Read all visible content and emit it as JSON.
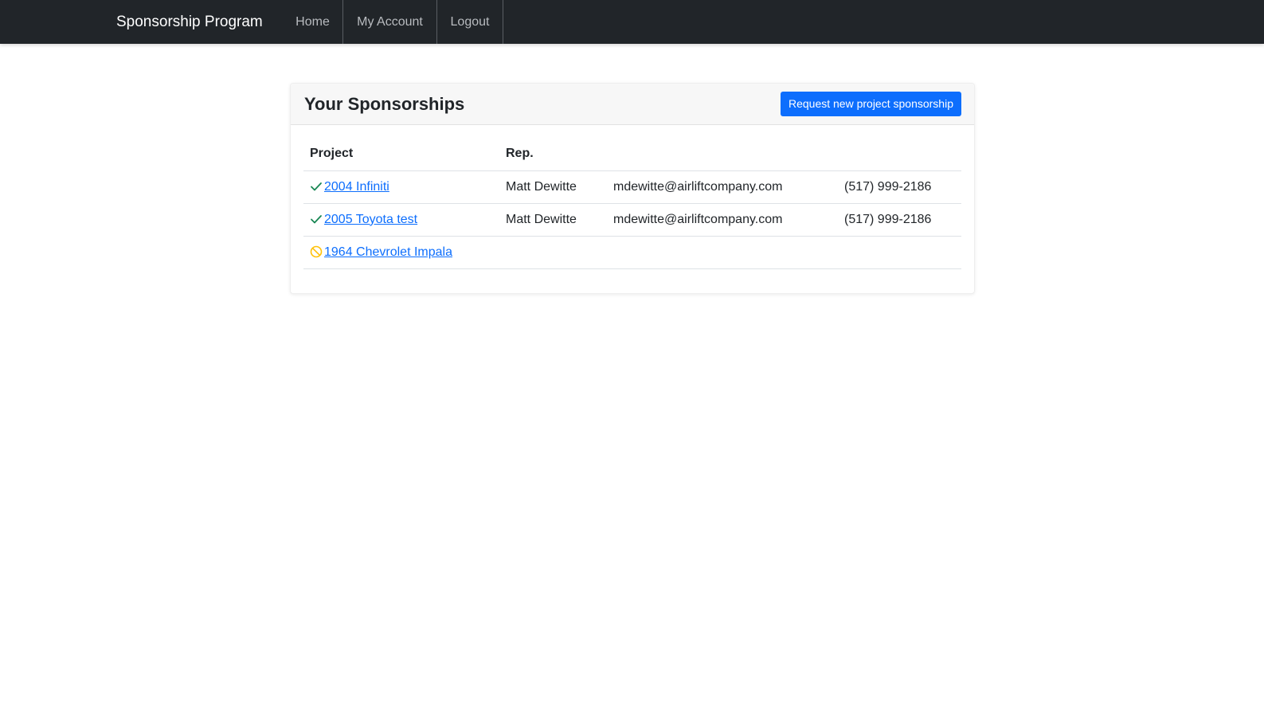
{
  "nav": {
    "brand": "Sponsorship Program",
    "links": [
      {
        "label": "Home"
      },
      {
        "label": "My Account"
      },
      {
        "label": "Logout"
      }
    ]
  },
  "card": {
    "title": "Your Sponsorships",
    "request_button": "Request new project sponsorship"
  },
  "table": {
    "headers": {
      "project": "Project",
      "rep": "Rep."
    },
    "rows": [
      {
        "status": "approved",
        "status_icon": "check-icon",
        "status_color": "#198754",
        "project": "2004 Infiniti",
        "rep": "Matt Dewitte",
        "email": "mdewitte@airliftcompany.com",
        "phone": "(517) 999-2186"
      },
      {
        "status": "approved",
        "status_icon": "check-icon",
        "status_color": "#198754",
        "project": "2005 Toyota test",
        "rep": "Matt Dewitte",
        "email": "mdewitte@airliftcompany.com",
        "phone": "(517) 999-2186"
      },
      {
        "status": "denied",
        "status_icon": "ban-icon",
        "status_color": "#ffc107",
        "project": "1964 Chevrolet Impala",
        "rep": "",
        "email": "",
        "phone": ""
      }
    ]
  },
  "colors": {
    "navbar_bg": "#212529",
    "primary": "#0d6efd",
    "success": "#198754",
    "warning": "#ffc107"
  }
}
